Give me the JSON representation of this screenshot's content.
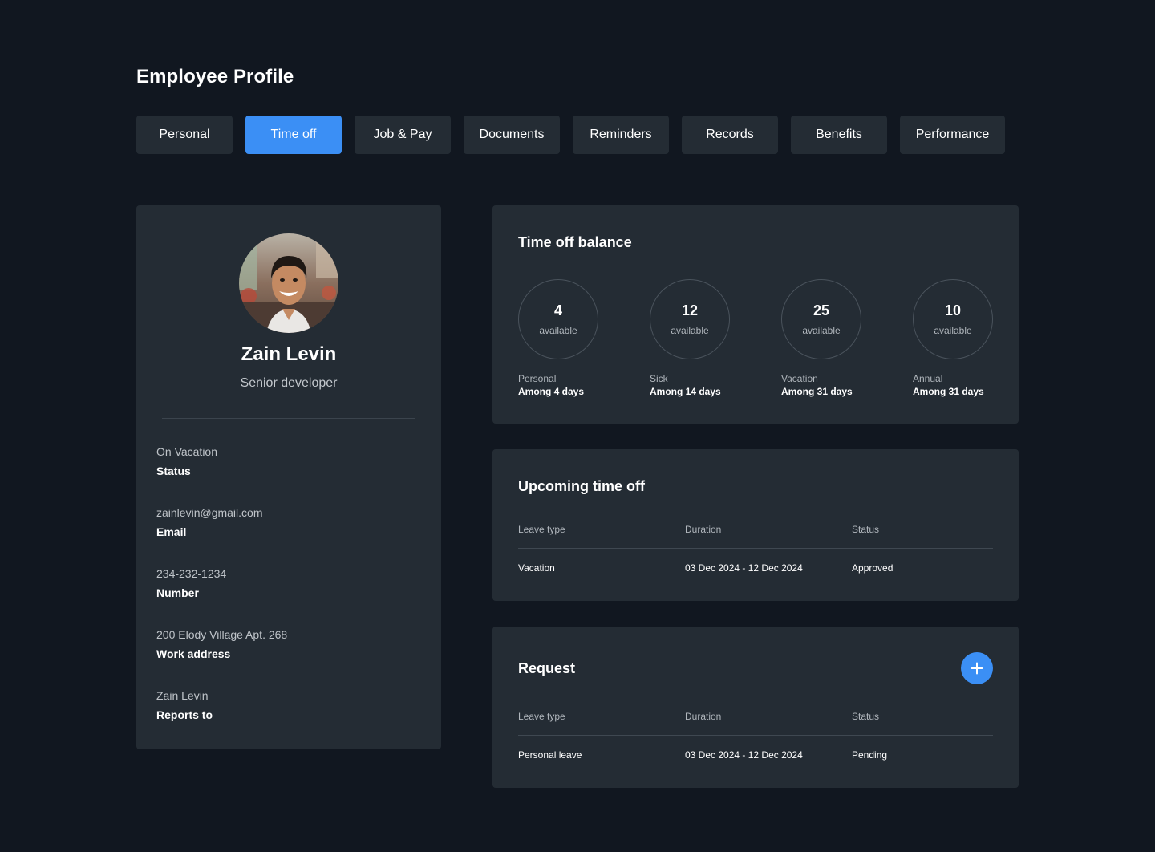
{
  "header": {
    "title": "Employee Profile"
  },
  "tabs": [
    {
      "label": "Personal"
    },
    {
      "label": "Time off"
    },
    {
      "label": "Job & Pay"
    },
    {
      "label": "Documents"
    },
    {
      "label": "Reminders"
    },
    {
      "label": "Records"
    },
    {
      "label": "Benefits"
    },
    {
      "label": "Performance"
    }
  ],
  "active_tab": "Time off",
  "profile": {
    "name": "Zain Levin",
    "role": "Senior developer",
    "fields": [
      {
        "value": "On Vacation",
        "label": "Status"
      },
      {
        "value": "zainlevin@gmail.com",
        "label": "Email"
      },
      {
        "value": "234-232-1234",
        "label": "Number"
      },
      {
        "value": "200 Elody Village Apt. 268",
        "label": "Work address"
      },
      {
        "value": "Zain Levin",
        "label": "Reports to"
      }
    ]
  },
  "balance": {
    "title": "Time off balance",
    "items": [
      {
        "count": "4",
        "unit": "available",
        "type": "Personal",
        "among": "Among 4 days"
      },
      {
        "count": "12",
        "unit": "available",
        "type": "Sick",
        "among": "Among 14 days"
      },
      {
        "count": "25",
        "unit": "available",
        "type": "Vacation",
        "among": "Among 31 days"
      },
      {
        "count": "10",
        "unit": "available",
        "type": "Annual",
        "among": "Among 31 days"
      }
    ]
  },
  "upcoming": {
    "title": "Upcoming time off",
    "columns": [
      "Leave type",
      "Duration",
      "Status"
    ],
    "rows": [
      {
        "leave_type": "Vacation",
        "duration": "03 Dec 2024 - 12 Dec 2024",
        "status": "Approved"
      }
    ]
  },
  "request": {
    "title": "Request",
    "columns": [
      "Leave type",
      "Duration",
      "Status"
    ],
    "rows": [
      {
        "leave_type": "Personal leave",
        "duration": "03 Dec 2024 - 12 Dec 2024",
        "status": "Pending"
      }
    ],
    "add_icon": "plus-icon"
  },
  "colors": {
    "background": "#111720",
    "card": "#242c34",
    "accent": "#3b8ff5"
  }
}
